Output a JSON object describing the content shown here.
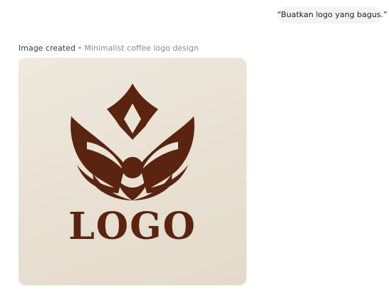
{
  "chat": {
    "user_message": "“Buatkan logo yang bagus.”"
  },
  "image_result": {
    "status": "Image created",
    "separator": "•",
    "caption": "Minimalist coffee logo design",
    "logo_text": "LOGO",
    "colors": {
      "background": "#ece5d8",
      "mark": "#5a2410"
    }
  }
}
